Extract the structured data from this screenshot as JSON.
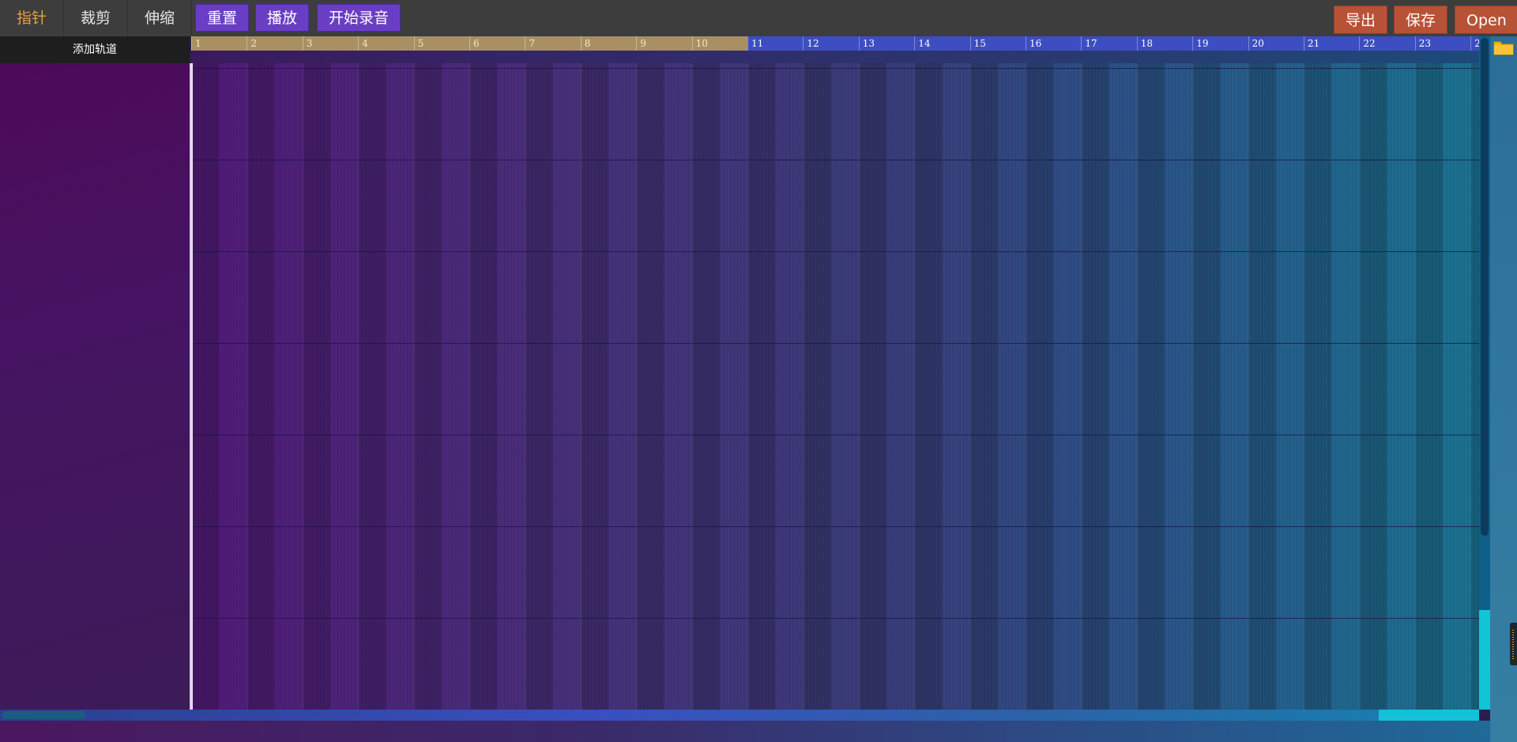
{
  "toolbar": {
    "tools": [
      {
        "label": "指针",
        "active": true
      },
      {
        "label": "裁剪",
        "active": false
      },
      {
        "label": "伸缩",
        "active": false
      }
    ],
    "reset_label": "重置",
    "play_label": "播放",
    "record_label": "开始录音",
    "export_label": "导出",
    "save_label": "保存",
    "open_label": "Open"
  },
  "tracks": {
    "add_track_label": "添加轨道"
  },
  "ruler": {
    "measures": [
      "1",
      "2",
      "3",
      "4",
      "5",
      "6",
      "7",
      "8",
      "9",
      "10",
      "11",
      "12",
      "13",
      "14",
      "15",
      "16",
      "17",
      "18",
      "19",
      "20",
      "21",
      "22",
      "23",
      "2"
    ],
    "loop_end_measure": 10
  },
  "colors": {
    "toolbar_bg": "#3d3d3d",
    "active_tool": "#e8a33a",
    "purple_button": "#6a3ec4",
    "red_button": "#b85236",
    "ruler_tan": "#a99062",
    "ruler_blue": "#3d4dc2"
  },
  "icons": {
    "folder": "folder-icon"
  }
}
